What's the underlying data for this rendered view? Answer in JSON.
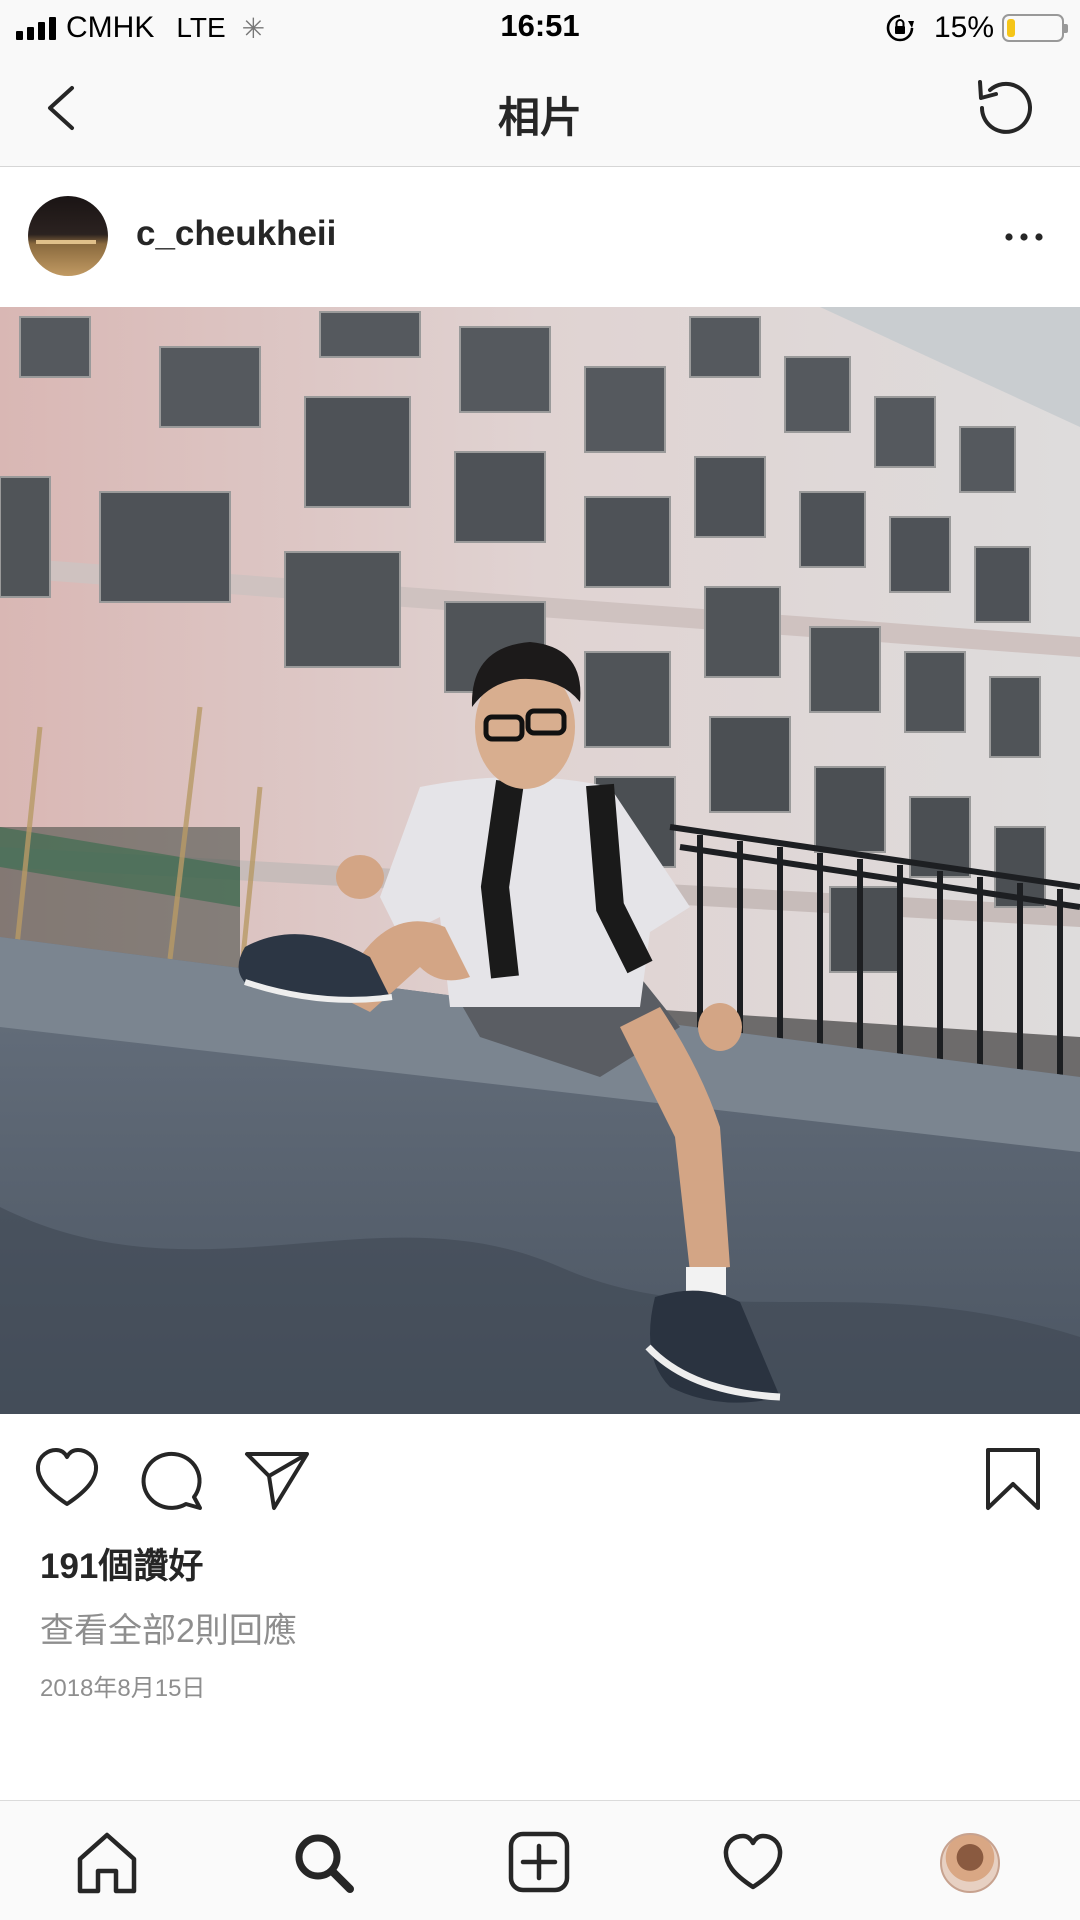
{
  "status_bar": {
    "carrier": "CMHK",
    "network": "LTE",
    "time": "16:51",
    "battery_percent": "15%",
    "battery_level": 0.15
  },
  "nav": {
    "title": "相片",
    "back_icon": "chevron-left-icon",
    "refresh_icon": "refresh-icon"
  },
  "post": {
    "username": "c_cheukheii",
    "image_alt": "",
    "likes": "191個讚好",
    "view_comments": "查看全部2則回應",
    "date": "2018年8月15日"
  },
  "tab_bar": {
    "items": [
      "home-icon",
      "search-icon",
      "add-post-icon",
      "activity-heart-icon",
      "profile-avatar"
    ]
  },
  "colors": {
    "text": "#262626",
    "secondary": "#8e8e8e",
    "battery": "#f5c518"
  }
}
